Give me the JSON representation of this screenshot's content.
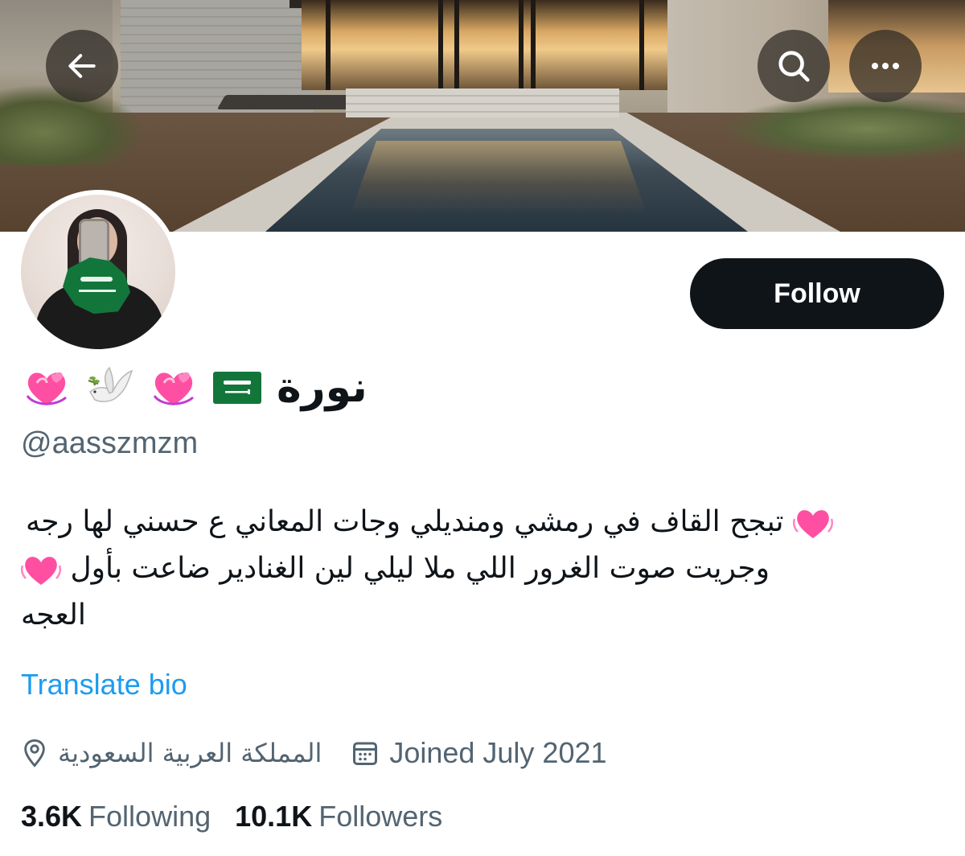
{
  "header": {
    "back_icon": "arrow-left-icon",
    "search_icon": "search-icon",
    "more_icon": "more-horizontal-icon"
  },
  "profile": {
    "display_name": "نورة",
    "name_emojis": [
      "saudi-flag-emoji",
      "revolving-hearts-emoji",
      "dove-emoji",
      "revolving-hearts-emoji"
    ],
    "handle": "@aasszmzm",
    "follow_label": "Follow",
    "bio": {
      "line1": "تبجح القاف في رمشي ومنديلي وجات المعاني ع حسني لها رجه",
      "line2": "وجريت صوت الغرور اللي ملا ليلي لين الغنادير ضاعت بأول",
      "line3": "العجه"
    },
    "translate_label": "Translate bio",
    "location": "المملكة العربية السعودية",
    "joined": "Joined July 2021",
    "following_count": "3.6K",
    "following_label": "Following",
    "followers_count": "10.1K",
    "followers_label": "Followers"
  },
  "colors": {
    "text_primary": "#0f1419",
    "text_secondary": "#536471",
    "link": "#1d9bf0",
    "follow_bg": "#0f1419",
    "heart_pink": "#ff4fa3"
  }
}
